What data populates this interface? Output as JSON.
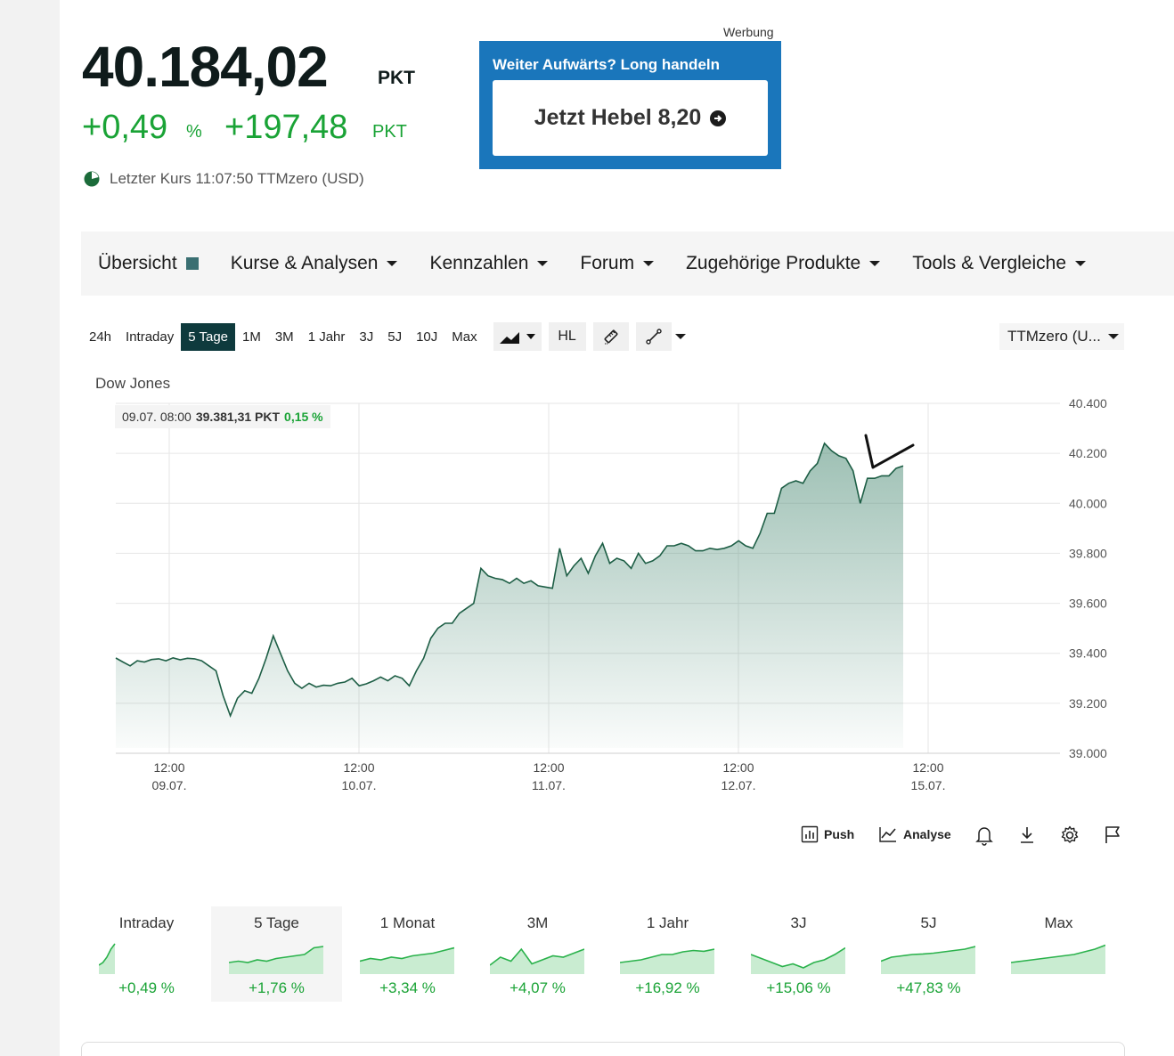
{
  "header": {
    "price": "40.184,02",
    "price_unit": "PKT",
    "change_pct": "+0,49",
    "change_pct_symbol": "%",
    "change_abs": "+197,48",
    "change_abs_unit": "PKT",
    "last_trade": "Letzter Kurs 11:07:50 TTMzero (USD)"
  },
  "ad": {
    "label": "Werbung",
    "title": "Weiter Aufwärts? Long handeln",
    "button": "Jetzt Hebel 8,20"
  },
  "nav": {
    "items": [
      {
        "label": "Übersicht"
      },
      {
        "label": "Kurse & Analysen"
      },
      {
        "label": "Kennzahlen"
      },
      {
        "label": "Forum"
      },
      {
        "label": "Zugehörige Produkte"
      },
      {
        "label": "Tools & Vergleiche"
      }
    ]
  },
  "toolbar": {
    "ranges": [
      "24h",
      "Intraday",
      "5 Tage",
      "1M",
      "3M",
      "1 Jahr",
      "3J",
      "5J",
      "10J",
      "Max"
    ],
    "active_range": "5 Tage",
    "hl_label": "HL",
    "source_select": "TTMzero (U..."
  },
  "tooltip": {
    "datetime": "09.07. 08:00",
    "value": "39.381,31 PKT",
    "pct": "0,15 %"
  },
  "chart_data": {
    "type": "area",
    "title": "Dow Jones",
    "accent_color": "#1d5e45",
    "ylim": [
      39000,
      40400
    ],
    "y_ticks": [
      "40.400",
      "40.200",
      "40.000",
      "39.800",
      "39.600",
      "39.400",
      "39.200",
      "39.000"
    ],
    "x_ticks": [
      {
        "time": "12:00",
        "date": "09.07."
      },
      {
        "time": "12:00",
        "date": "10.07."
      },
      {
        "time": "12:00",
        "date": "11.07."
      },
      {
        "time": "12:00",
        "date": "12.07."
      },
      {
        "time": "12:00",
        "date": "15.07."
      }
    ],
    "grid": true,
    "series": [
      {
        "values": [
          39381,
          39365,
          39350,
          39370,
          39365,
          39375,
          39378,
          39370,
          39382,
          39374,
          39380,
          39378,
          39370,
          39350,
          39330,
          39230,
          39150,
          39220,
          39250,
          39240,
          39300,
          39380,
          39470,
          39400,
          39330,
          39280,
          39260,
          39280,
          39265,
          39272,
          39270,
          39280,
          39285,
          39300,
          39270,
          39278,
          39290,
          39305,
          39290,
          39310,
          39300,
          39270,
          39330,
          39380,
          39460,
          39500,
          39520,
          39520,
          39560,
          39580,
          39600,
          39740,
          39710,
          39700,
          39695,
          39680,
          39700,
          39680,
          39690,
          39670,
          39665,
          39660,
          39820,
          39710,
          39750,
          39780,
          39720,
          39790,
          39840,
          39760,
          39780,
          39770,
          39740,
          39800,
          39760,
          39770,
          39790,
          39830,
          39830,
          39840,
          39830,
          39810,
          39810,
          39820,
          39815,
          39820,
          39830,
          39850,
          39830,
          39820,
          39880,
          39960,
          39960,
          40060,
          40080,
          40090,
          40080,
          40130,
          40160,
          40240,
          40210,
          40190,
          40180,
          40130,
          40000,
          40100,
          40100,
          40110,
          40110,
          40140,
          40150
        ]
      }
    ]
  },
  "actions": {
    "push": "Push",
    "analyse": "Analyse"
  },
  "performance": [
    {
      "label": "Intraday",
      "value": "+0,49 %",
      "active": false
    },
    {
      "label": "5 Tage",
      "value": "+1,76 %",
      "active": true
    },
    {
      "label": "1 Monat",
      "value": "+3,34 %",
      "active": false
    },
    {
      "label": "3M",
      "value": "+4,07 %",
      "active": false
    },
    {
      "label": "1 Jahr",
      "value": "+16,92 %",
      "active": false
    },
    {
      "label": "3J",
      "value": "+15,06 %",
      "active": false
    },
    {
      "label": "5J",
      "value": "+47,83 %",
      "active": false
    },
    {
      "label": "Max",
      "value": "",
      "active": false
    }
  ]
}
